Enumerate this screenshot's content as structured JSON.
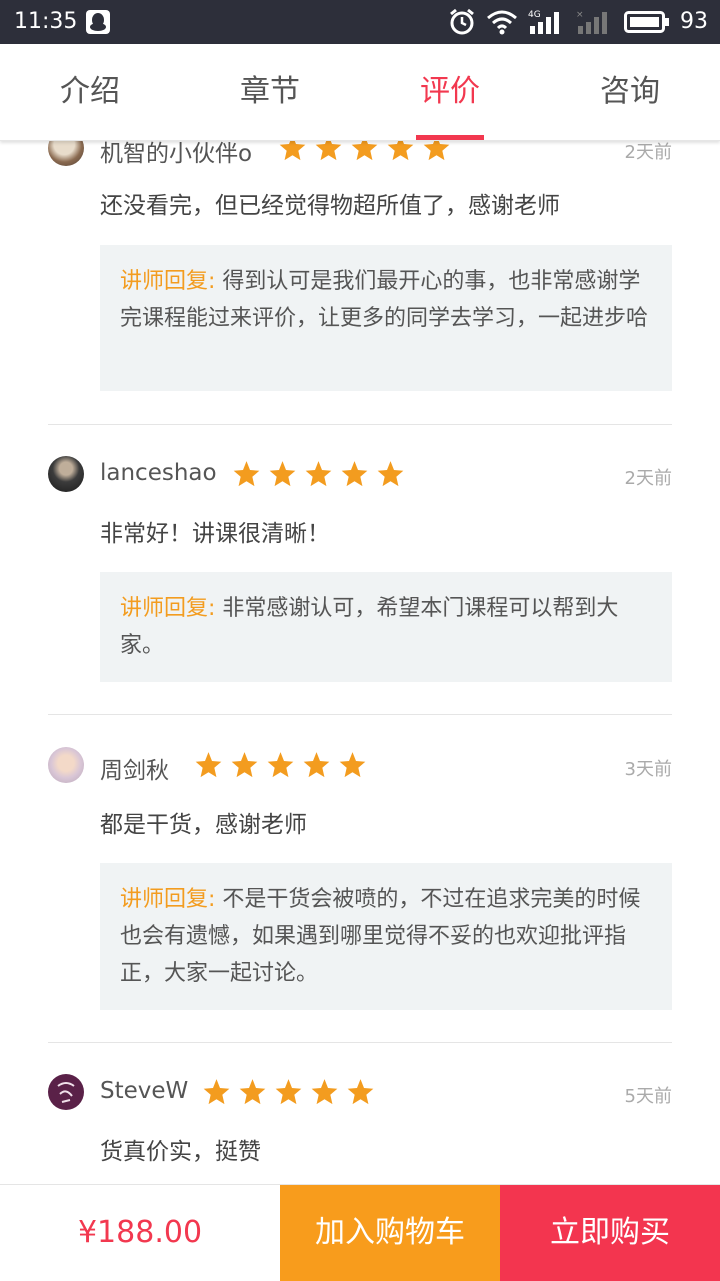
{
  "status_bar": {
    "time": "11:35",
    "battery": "93",
    "icons": [
      "qq-icon",
      "alarm-icon",
      "wifi-icon",
      "signal-4g-icon",
      "signal-empty-icon",
      "battery-icon"
    ]
  },
  "tabs": [
    {
      "label": "介绍",
      "active": false
    },
    {
      "label": "章节",
      "active": false
    },
    {
      "label": "评价",
      "active": true
    },
    {
      "label": "咨询",
      "active": false
    }
  ],
  "reviews": [
    {
      "user": "机智的小伙伴o",
      "rating": 5,
      "time": "2天前",
      "content": "还没看完，但已经觉得物超所值了，感谢老师",
      "reply_label": "讲师回复:",
      "reply_text": " 得到认可是我们最开心的事，也非常感谢学完课程能过来评价，让更多的同学去学习，一起进步哈"
    },
    {
      "user": "lanceshao",
      "rating": 5,
      "time": "2天前",
      "content": "非常好！讲课很清晰！",
      "reply_label": "讲师回复:",
      "reply_text": " 非常感谢认可，希望本门课程可以帮到大家。"
    },
    {
      "user": "周剑秋",
      "rating": 5,
      "time": "3天前",
      "content": "都是干货，感谢老师",
      "reply_label": "讲师回复:",
      "reply_text": " 不是干货会被喷的，不过在追求完美的时候也会有遗憾，如果遇到哪里觉得不妥的也欢迎批评指正，大家一起讨论。"
    },
    {
      "user": "SteveW",
      "rating": 5,
      "time": "5天前",
      "content": "货真价实，挺赞",
      "reply_label": "",
      "reply_text": ""
    }
  ],
  "bottom_bar": {
    "price": "¥188.00",
    "add_to_cart": "加入购物车",
    "buy_now": "立即购买"
  },
  "colors": {
    "accent": "#f2384f",
    "star": "#f39c1f",
    "cart_button": "#f89c1c",
    "buy_button": "#f3354f",
    "reply_bg": "#f0f3f4"
  }
}
